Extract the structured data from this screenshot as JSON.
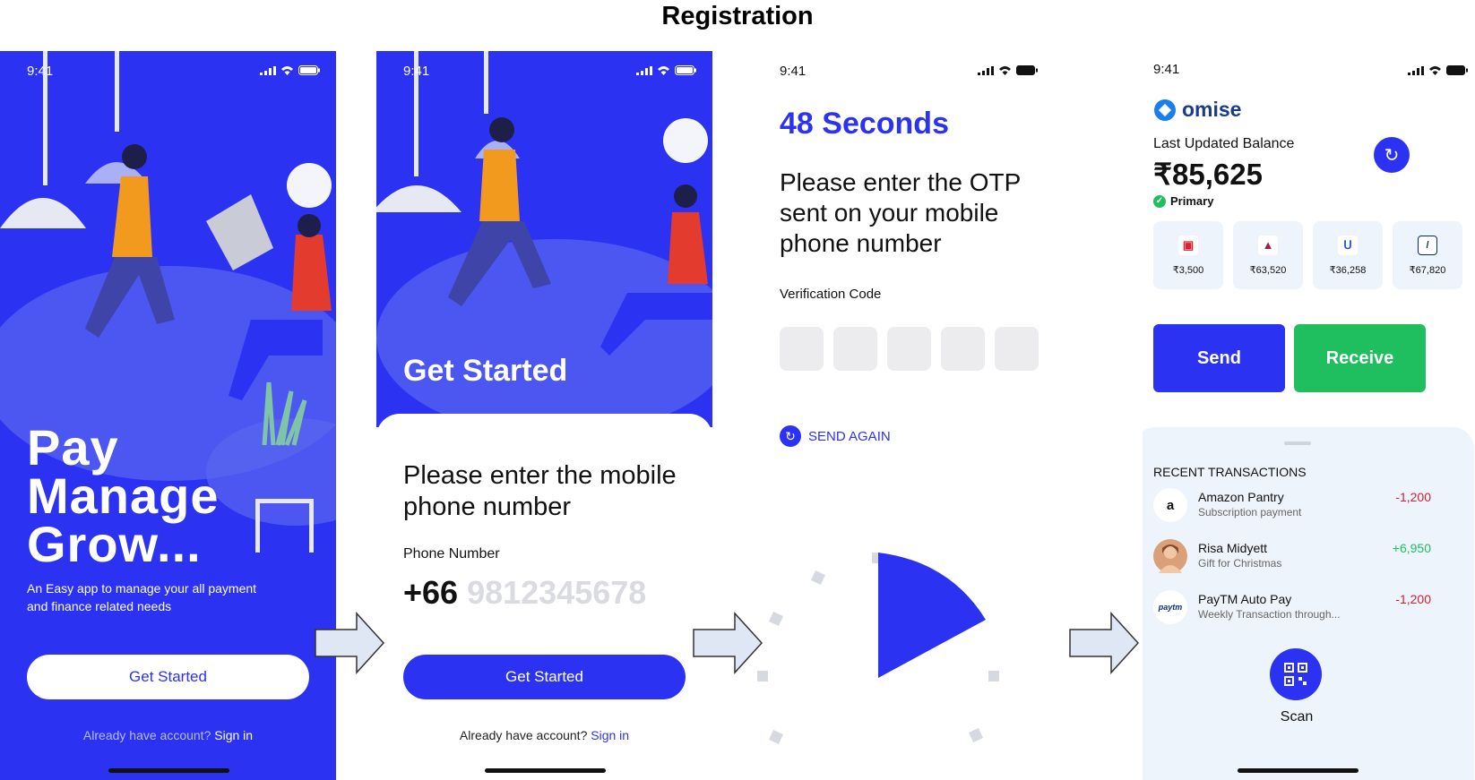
{
  "title": "Registration",
  "status_time": "9:41",
  "screen1": {
    "hero_lines": [
      "Pay",
      "Manage",
      "Grow..."
    ],
    "subtitle": "An Easy app to manage your all payment and finance related needs",
    "cta": "Get Started",
    "already_text": "Already have account?",
    "sign_in": "Sign in"
  },
  "screen2": {
    "heading": "Get Started",
    "question": "Please enter the mobile phone number",
    "phone_label": "Phone Number",
    "country_code": "+66",
    "phone_placeholder": "9812345678",
    "cta": "Get Started",
    "already_text": "Already have account?",
    "sign_in": "Sign in"
  },
  "screen3": {
    "seconds": "48 Seconds",
    "question": "Please enter the OTP sent on your mobile phone number",
    "code_label": "Verification Code",
    "send_again": "SEND AGAIN"
  },
  "screen4": {
    "brand": "omise",
    "balance_label": "Last Updated Balance",
    "balance": "₹85,625",
    "primary": "Primary",
    "banks": [
      {
        "amount": "₹3,500",
        "color": "#e01f2d"
      },
      {
        "amount": "₹63,520",
        "color": "#9c1d4f"
      },
      {
        "amount": "₹36,258",
        "color": "#2b4fd6"
      },
      {
        "amount": "₹67,820",
        "color": "#0a2a6b"
      }
    ],
    "send": "Send",
    "receive": "Receive",
    "recent_title": "RECENT TRANSACTIONS",
    "transactions": [
      {
        "name": "Amazon Pantry",
        "desc": "Subscription payment",
        "amount": "-1,200",
        "avatar": "a"
      },
      {
        "name": "Risa Midyett",
        "desc": "Gift for Christmas",
        "amount": "+6,950",
        "avatar": ""
      },
      {
        "name": "PayTM Auto Pay",
        "desc": "Weekly Transaction through...",
        "amount": "-1,200",
        "avatar": "paytm"
      }
    ],
    "scan": "Scan"
  },
  "colors": {
    "brand_blue": "#2b32f2",
    "green": "#1fbf5f",
    "negative": "#d32030"
  }
}
